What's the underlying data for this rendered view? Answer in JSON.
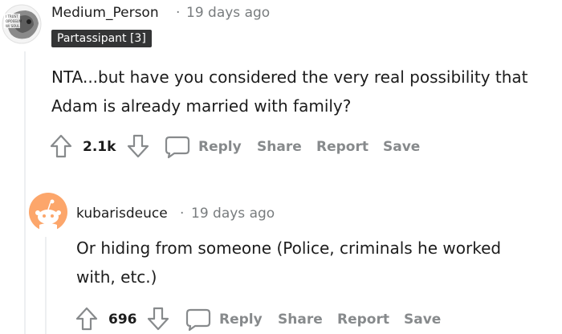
{
  "comments": [
    {
      "author": "Medium_Person",
      "separator": "·",
      "time": "19 days ago",
      "flair": "Partassipant [3]",
      "body_line1": "NTA...but have you considered the very real possibility that",
      "body_line2": "Adam is already married with family?",
      "score": "2.1k",
      "actions": {
        "reply": "Reply",
        "share": "Share",
        "report": "Report",
        "save": "Save"
      }
    },
    {
      "author": "kubarisdeuce",
      "separator": "·",
      "time": "19 days ago",
      "body_line1": "Or hiding from someone (Police, criminals he worked",
      "body_line2": "with, etc.)",
      "score": "696",
      "actions": {
        "reply": "Reply",
        "share": "Share",
        "report": "Report",
        "save": "Save"
      }
    }
  ],
  "colors": {
    "meta": "#787c7e",
    "action": "#878a8c",
    "avatar_orange": "#fca66b",
    "thread_line": "#edeff1"
  },
  "icons": [
    "upvote-icon",
    "downvote-icon",
    "comment-bubble-icon",
    "snoo-avatar-icon"
  ]
}
